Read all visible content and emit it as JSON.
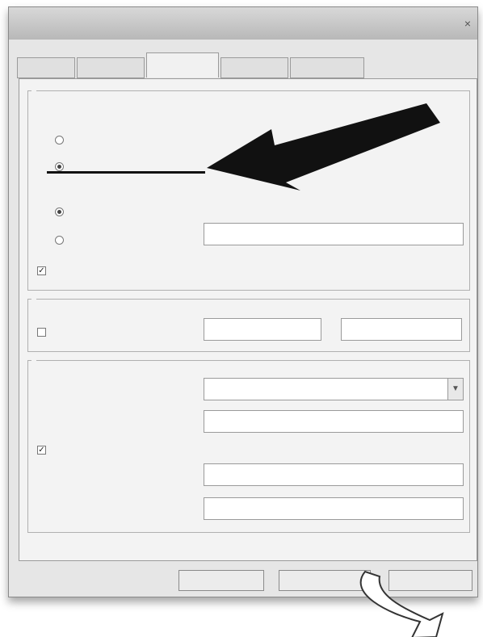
{
  "window": {
    "title": "",
    "close_label": "×"
  },
  "tabs": [
    {
      "label": ""
    },
    {
      "label": ""
    },
    {
      "label": ""
    },
    {
      "label": ""
    },
    {
      "label": ""
    }
  ],
  "groups": {
    "firewall_traversal": {
      "label": ""
    },
    "ip_address": {
      "label": ""
    },
    "stun_server": {
      "label": ""
    },
    "port_range": {
      "label": ""
    },
    "proxy": {
      "label": ""
    }
  },
  "firewall": {
    "discover_global": {
      "label": "",
      "checked": false
    },
    "use_local": {
      "label": "",
      "checked": true
    },
    "stun_discover": {
      "label": "",
      "checked": true
    },
    "stun_specified": {
      "label": "",
      "checked": false,
      "value": ""
    },
    "enable": {
      "label": "",
      "checked": true
    }
  },
  "ports": {
    "manual": {
      "label": "",
      "checked": false
    },
    "from": "",
    "separator": "",
    "to": ""
  },
  "proxy": {
    "type": {
      "label": "",
      "value": ""
    },
    "address": {
      "label": "",
      "value": ""
    },
    "auth": {
      "label": "",
      "checked": true
    },
    "username": {
      "label": "",
      "value": ""
    },
    "password": {
      "label": "",
      "value": ""
    }
  },
  "buttons": {
    "ok": "",
    "cancel": "",
    "apply": ""
  },
  "colors": {
    "annotation": "#111111"
  }
}
